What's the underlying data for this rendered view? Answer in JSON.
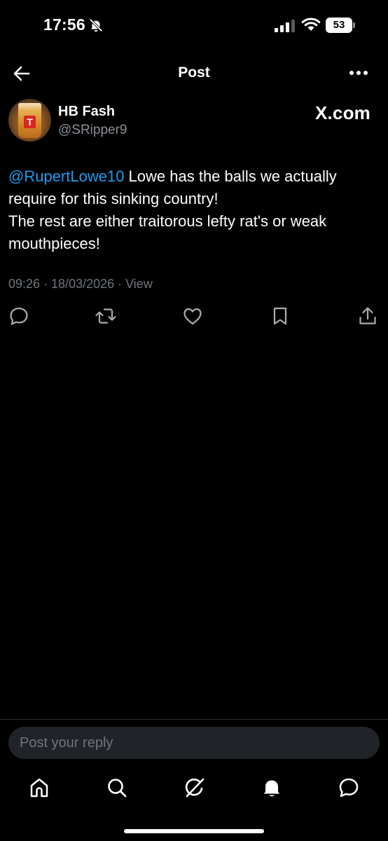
{
  "status_bar": {
    "time": "17:56",
    "battery": "53"
  },
  "header": {
    "title": "Post"
  },
  "post": {
    "author": {
      "display_name": "HB Fash",
      "handle": "@SRipper9",
      "avatar_mark": "T"
    },
    "watermark": "X.com",
    "mention": "@RupertLowe10",
    "text_line1_rest": " Lowe has the balls we actually require for this sinking country!",
    "text_line2": "The rest are either traitorous lefty rat's or weak mouthpieces!",
    "meta": "09:26 · 18/03/2026 · View"
  },
  "actions": [
    "reply-icon",
    "repost-icon",
    "like-icon",
    "bookmark-icon",
    "share-icon"
  ],
  "reply": {
    "placeholder": "Post your reply"
  },
  "bottom_nav": [
    "home-icon",
    "search-icon",
    "grok-icon",
    "notifications-icon",
    "messages-icon"
  ],
  "colors": {
    "background": "#000000",
    "mention": "#1d9bf0",
    "secondary_text": "#71767b",
    "reply_box": "#202327"
  }
}
